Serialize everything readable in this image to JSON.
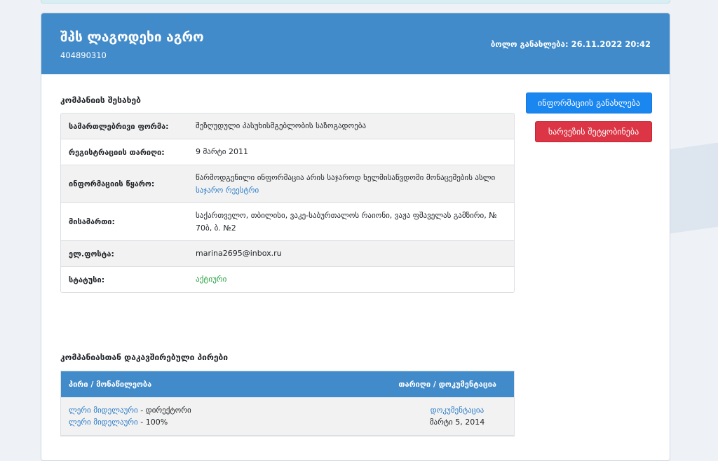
{
  "company": {
    "name": "შპს ლაგოდეხი აგრო",
    "id": "404890310",
    "last_update": "ბოლო განახლება: 26.11.2022 20:42"
  },
  "about": {
    "title": "კომპანიის შესახებ",
    "rows": [
      {
        "label": "სამართლებრივი ფორმა:",
        "value": "შეზღუდული პასუხისმგებლობის საზოგადოება"
      },
      {
        "label": "რეგისტრაციის თარიღი:",
        "value": "9 მარტი 2011"
      },
      {
        "label": "ინფორმაციის წყარო:",
        "value": "წარმოდგენილი ინფორმაცია არის საჯაროდ ხელმისაწვდომი მონაცემების ასლი",
        "link": "საჯარო რეესტრი"
      },
      {
        "label": "მისამართი:",
        "value": "საქართველო, თბილისი, ვაკე-საბურთალოს რაიონი, ვაჟა ფშაველას გამზირი, № 70ბ, ბ. №2"
      },
      {
        "label": "ელ.ფოსტა:",
        "value": "marina2695@inbox.ru"
      },
      {
        "label": "სტატუსი:",
        "value": "აქტიური"
      }
    ]
  },
  "actions": {
    "update_label": "ინფორმაციის განახლება",
    "report_label": "ხარვეზის შეტყობინება"
  },
  "persons": {
    "title": "კომპანიასთან დაკავშირებული პირები",
    "col_person": "პირი / მონაწილეობა",
    "col_date": "თარიღი / დოკუმენტაცია",
    "rows": [
      {
        "line1_name": "ლერი მიდელაური",
        "line1_role": " - დირექტორი",
        "line2_name": "ლერი მიდელაური",
        "line2_role": " - 100%",
        "doc_link": "დოკუმენტაცია",
        "date": "მარტი 5, 2014"
      }
    ]
  },
  "colors": {
    "header_bg": "#428bca",
    "primary": "#1a86f0",
    "danger": "#dc3545",
    "status_active": "#1e9e3a",
    "link": "#2a7bc8"
  }
}
